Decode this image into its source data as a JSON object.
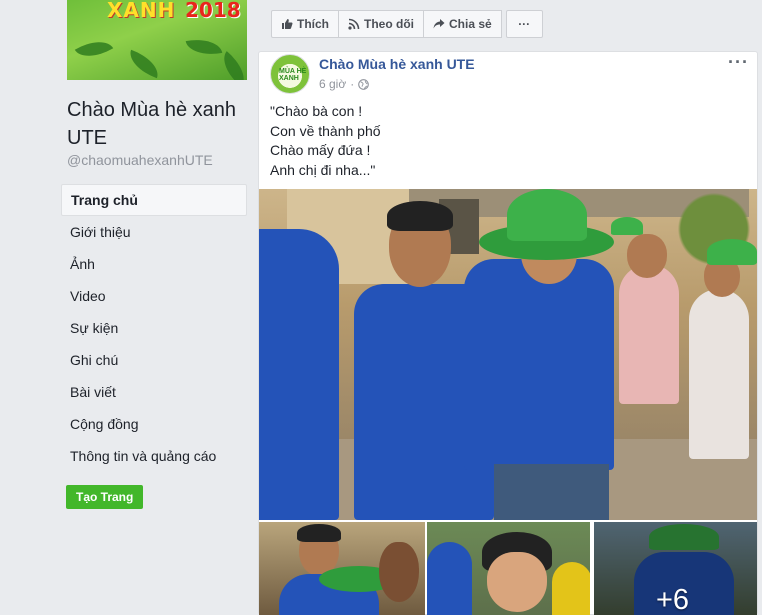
{
  "page": {
    "cover_text": "XANH",
    "cover_year": "2018",
    "name": "Chào Mùa hè xanh UTE",
    "handle": "@chaomuahexanhUTE"
  },
  "nav": {
    "items": [
      {
        "label": "Trang chủ",
        "active": true
      },
      {
        "label": "Giới thiệu"
      },
      {
        "label": "Ảnh"
      },
      {
        "label": "Video"
      },
      {
        "label": "Sự kiện"
      },
      {
        "label": "Ghi chú"
      },
      {
        "label": "Bài viết"
      },
      {
        "label": "Cộng đồng"
      },
      {
        "label": "Thông tin và quảng cáo"
      }
    ],
    "create_page": "Tạo Trang"
  },
  "actions": {
    "like": "Thích",
    "follow": "Theo dõi",
    "share": "Chia sẻ",
    "more": "···"
  },
  "post": {
    "author": "Chào Mùa hè xanh UTE",
    "avatar_text": "MÙA HÈ XANH",
    "time": "6 giờ",
    "privacy_icon": "globe-icon",
    "menu": "···",
    "lines": [
      "\"Chào bà con !",
      "Con về thành phố",
      "Chào mấy đứa !",
      "Anh chị đi nha...\""
    ],
    "more_photos": "+6"
  },
  "colors": {
    "link": "#365899",
    "green_button": "#42b72a",
    "background": "#e9ebee"
  }
}
